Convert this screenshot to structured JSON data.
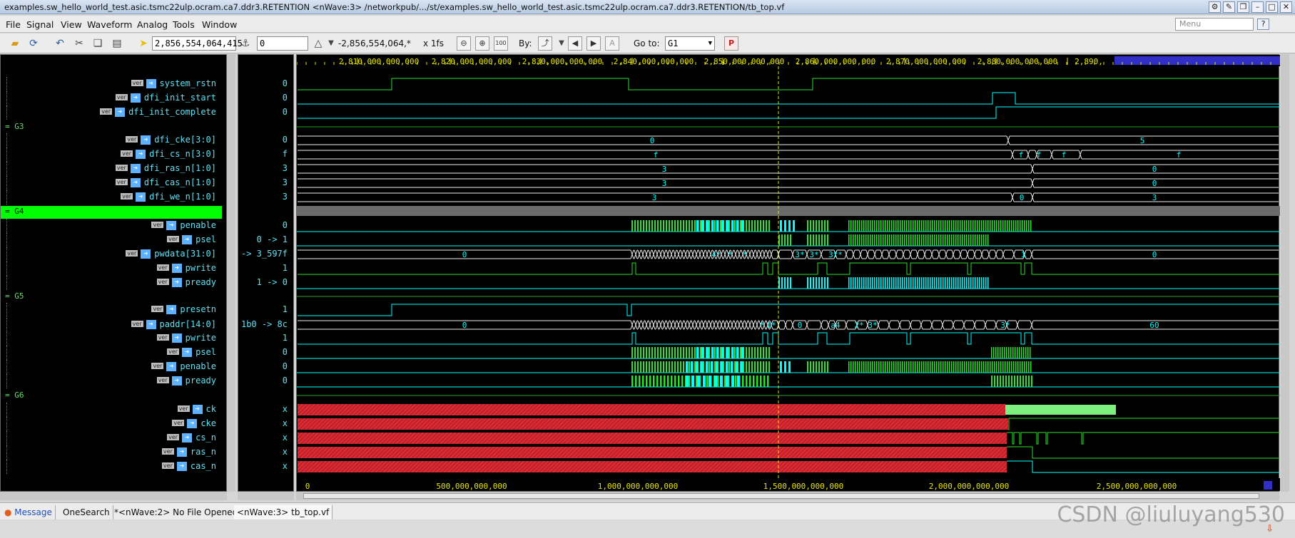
{
  "window": {
    "title": "examples.sw_hello_world_test.asic.tsmc22ulp.ocram.ca7.ddr3.RETENTION <nWave:3> /networkpub/.../st/examples.sw_hello_world_test.asic.tsmc22ulp.ocram.ca7.ddr3.RETENTION/tb_top.vf"
  },
  "menubar": {
    "items": [
      "File",
      "Signal",
      "View",
      "Waveform",
      "Analog",
      "Tools",
      "Window"
    ],
    "search_placeholder": "Menu"
  },
  "toolbar": {
    "cursor_time": "2,856,554,064,415",
    "marker_time": "0",
    "delta": "-2,856,554,064,*",
    "unit": "x 1fs",
    "by_label": "By:",
    "goto_label": "Go to:",
    "goto_value": "G1"
  },
  "top_ruler": [
    "2,810,000,000,000",
    "2,820,000,000,000",
    "2,830,000,000,000",
    "2,840,000,000,000",
    "2,850,000,000,000",
    "2,860,000,000,000",
    "2,870,000,000,000",
    "2,880,000,000,000",
    "2,890,"
  ],
  "bottom_ruler": [
    "0",
    "500,000,000,000",
    "1,000,000,000,000",
    "1,500,000,000,000",
    "2,000,000,000,000",
    "2,500,000,000,000"
  ],
  "badge": "ver",
  "rows": [
    {
      "kind": "signal",
      "name": "system_rstn",
      "value": "0"
    },
    {
      "kind": "signal",
      "name": "dfi_init_start",
      "value": "0"
    },
    {
      "kind": "signal",
      "name": "dfi_init_complete",
      "value": "0"
    },
    {
      "kind": "group",
      "name": "G3"
    },
    {
      "kind": "signal",
      "name": "dfi_cke[3:0]",
      "value": "0"
    },
    {
      "kind": "signal",
      "name": "dfi_cs_n[3:0]",
      "value": "f"
    },
    {
      "kind": "signal",
      "name": "dfi_ras_n[1:0]",
      "value": "3"
    },
    {
      "kind": "signal",
      "name": "dfi_cas_n[1:0]",
      "value": "3"
    },
    {
      "kind": "signal",
      "name": "dfi_we_n[1:0]",
      "value": "3"
    },
    {
      "kind": "group",
      "name": "G4"
    },
    {
      "kind": "signal",
      "name": "penable",
      "value": "0"
    },
    {
      "kind": "signal",
      "name": "psel",
      "value": "0 -> 1"
    },
    {
      "kind": "signal",
      "name": "pwdata[31:0]",
      "value": "0 -> 3_597f"
    },
    {
      "kind": "signal",
      "name": "pwrite",
      "value": "1"
    },
    {
      "kind": "signal",
      "name": "pready",
      "value": "1 -> 0"
    },
    {
      "kind": "group",
      "name": "G5"
    },
    {
      "kind": "signal",
      "name": "presetn",
      "value": "1"
    },
    {
      "kind": "signal",
      "name": "paddr[14:0]",
      "value": "1b0 -> 8c"
    },
    {
      "kind": "signal",
      "name": "pwrite",
      "value": "1"
    },
    {
      "kind": "signal",
      "name": "psel",
      "value": "0"
    },
    {
      "kind": "signal",
      "name": "penable",
      "value": "0"
    },
    {
      "kind": "signal",
      "name": "pready",
      "value": "0"
    },
    {
      "kind": "group",
      "name": "G6"
    },
    {
      "kind": "signal",
      "name": "ck",
      "value": "x"
    },
    {
      "kind": "signal",
      "name": "cke",
      "value": "x"
    },
    {
      "kind": "signal",
      "name": "cs_n",
      "value": "x"
    },
    {
      "kind": "signal",
      "name": "ras_n",
      "value": "x"
    },
    {
      "kind": "signal",
      "name": "cas_n",
      "value": "x"
    }
  ],
  "bus_labels": {
    "dfi_cke": [
      "0",
      "5"
    ],
    "dfi_cs_n": [
      "f",
      "f",
      "f",
      "f",
      "f"
    ],
    "dfi_ras_n": [
      "3",
      "0"
    ],
    "dfi_cas_n": [
      "3",
      "0"
    ],
    "dfi_we_n": [
      "3",
      "0",
      "3"
    ],
    "pwdata": [
      "0",
      "4*",
      "*",
      "*",
      "3*",
      "3*",
      "3f*",
      "1",
      "0"
    ],
    "paddr": [
      "0",
      "*",
      "1*",
      "0",
      "a4",
      "2*",
      "3*",
      "3*",
      "60"
    ]
  },
  "statusbar": {
    "tabs": [
      "Message",
      "OneSearch",
      "*<nWave:2> No File Opened",
      "<nWave:3> tb_top.vf"
    ]
  },
  "watermark": "CSDN @liuluyang530",
  "colors": {
    "wave_green": "#2ce22c",
    "wave_cyan": "#00ffff",
    "bus_white": "#f2f2f2",
    "highlight_group": "#00ff00",
    "x_state": "#c8202a",
    "cursor": "#e6e600",
    "ruler_text": "#e6e600"
  }
}
